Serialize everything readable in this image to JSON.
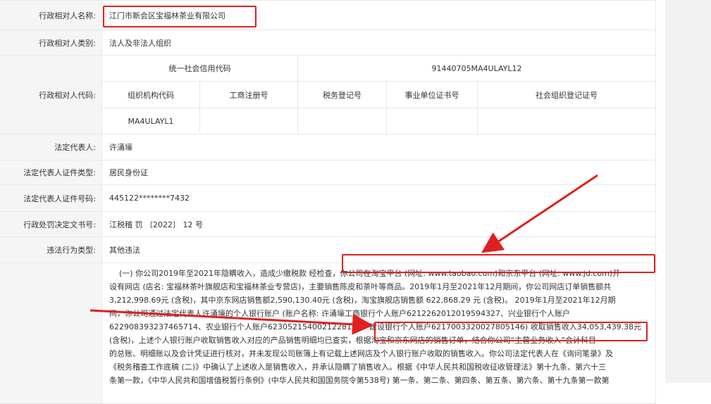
{
  "rows": {
    "name": {
      "label": "行政相对人名称:",
      "value": "江门市新会区宝福林茶业有限公司"
    },
    "category": {
      "label": "行政相对人类别:",
      "value": "法人及非法人组织"
    },
    "code": {
      "label": "行政相对人代码:",
      "credit_code_label": "统一社会信用代码",
      "credit_code_value": "91440705MA4ULAYL12",
      "headers": [
        "组织机构代码",
        "工商注册号",
        "税务登记号",
        "事业单位证书号",
        "社会组织登记证号"
      ],
      "values": [
        "MA4ULAYL1",
        "",
        "",
        "",
        ""
      ]
    },
    "legal_rep": {
      "label": "法定代表人:",
      "value": "许涌壕"
    },
    "id_type": {
      "label": "法定代表人证件类型:",
      "value": "居民身份证"
    },
    "id_number": {
      "label": "法定代表人证件号码:",
      "value": "445122********7432"
    },
    "decision_no": {
      "label": "行政处罚决定文书号:",
      "value": "江税稽 罚 〔2022〕 12 号"
    },
    "violation_type": {
      "label": "违法行为类型:",
      "value": "其他违法"
    }
  },
  "description": {
    "lines": [
      "    (一) 你公司2019年至2021年隐瞒收入，造成少缴税款 经检查，你公司在淘宝平台 (网址: www.taobao.com)和京东平台 (网址: www.jd.com)开",
      "设有网店 (店名: 宝福林茶叶旗舰店和宝福林茶业专营店)，主要销售陈皮和茶叶等商品。2019年1月至2021年12月期间，你公司网店订单销售额共",
      "3,212,998.69元 (含税)，其中京东网店销售额2,590,130.40元 (含税)，淘宝旗舰店销售额 622,868.29 元 (含税)。 2019年1月至2021年12月期",
      "间，你公司通过法定代表人许涌壕的个人银行账户 (账户名称: 许涌壕工商银行个人账户6212262012019594327、兴业银行个人账户",
      "622908393237465714、农业银行个人账户6230521540021228178、建设银行个人账户6217003320027805146) 收取销售收入34,053,439.38元",
      "(含税)，上述个人银行账户收取销售收入对应的产品销售明细均已查实，根据淘宝和京东网店的销售订单，结合你公司“主营业务收入”会计科目",
      "的总账、明细账以及会计凭证进行核对，并未发现公司账簿上有记载上述网店及个人银行账户收取的销售收入。你公司法定代表人在《询问笔录》及",
      "《税务稽查工作底稿 (二)》中确认了上述收入是销售收入，并承认隐瞒了销售收入。根据《中华人民共和国税收征收管理法》第十九条、第六十三",
      "条第一款，《中华人民共和国增值税暂行条例》(中华人民共和国国务院令第538号) 第一条、第二条、第四条、第五条、第六条、第十九条第一款第"
    ]
  },
  "annotations": {
    "color": "#e02020"
  }
}
